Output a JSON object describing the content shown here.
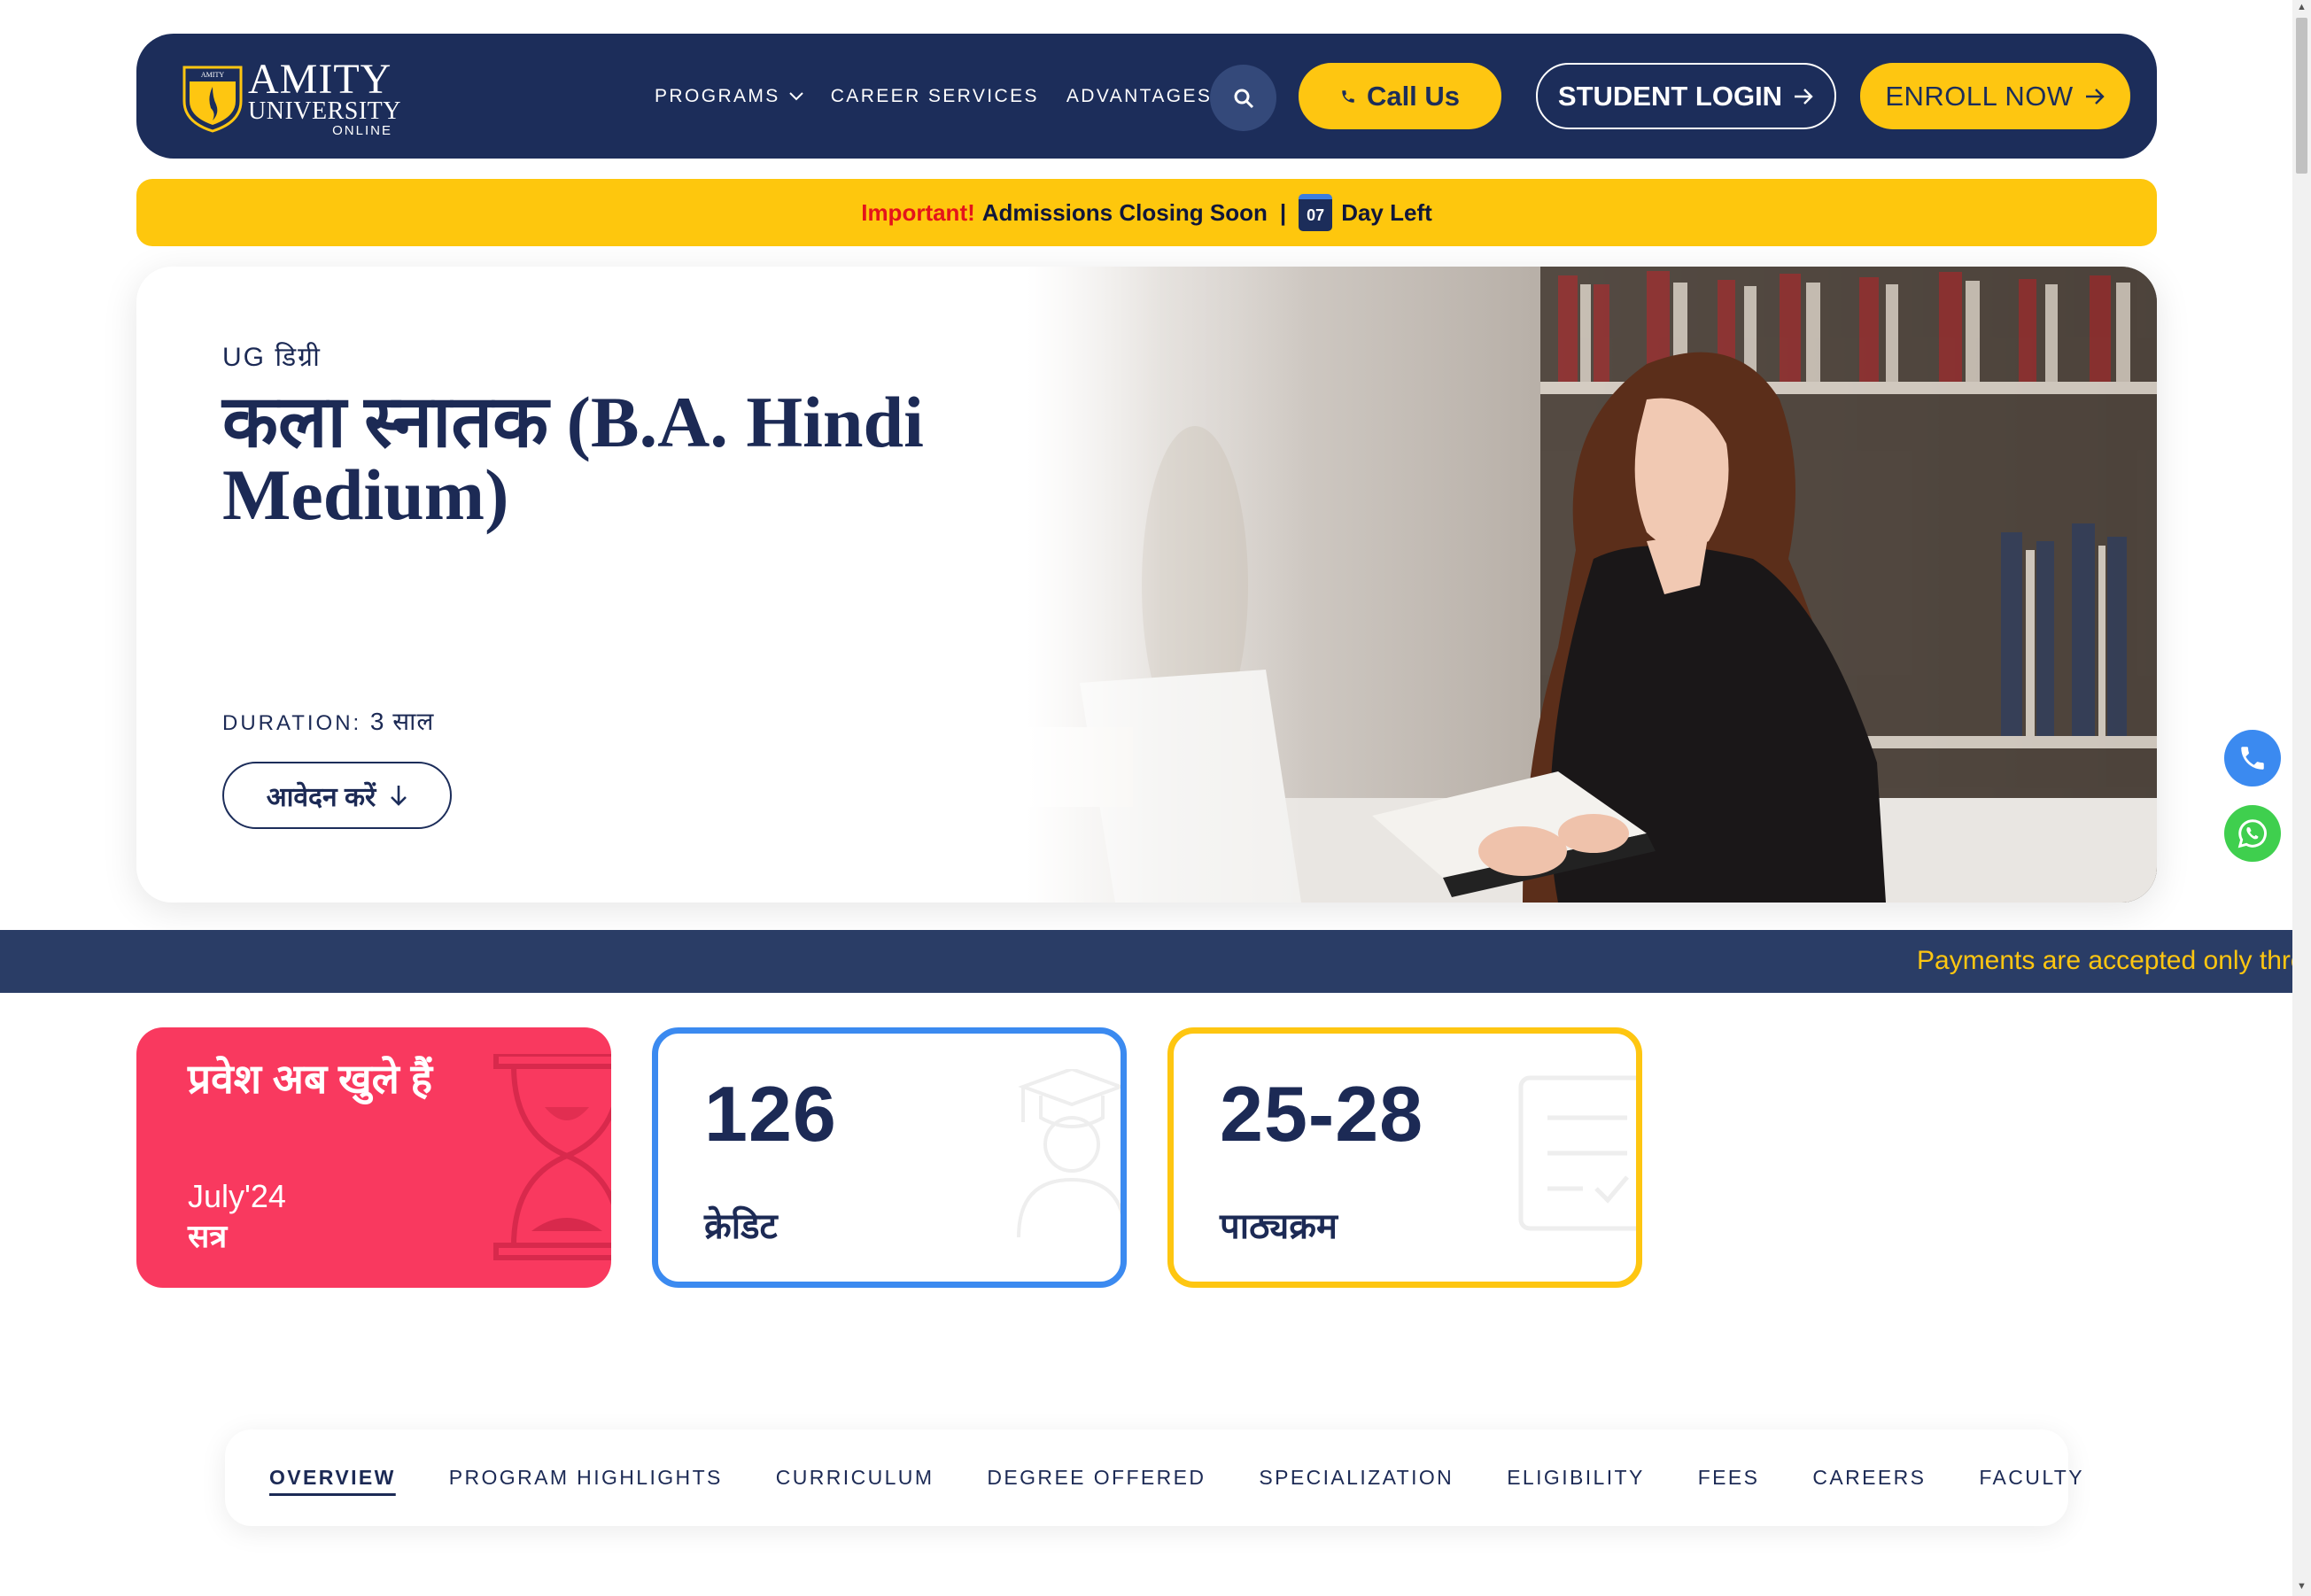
{
  "brand": {
    "name_line1": "AMITY",
    "name_line2": "UNIVERSITY",
    "name_line3": "ONLINE",
    "shield_text": "AMITY UNIVERSITY",
    "navy": "#1c2d5a",
    "yellow": "#fec611"
  },
  "nav": {
    "items": [
      {
        "label": "PROGRAMS",
        "has_dropdown": true
      },
      {
        "label": "CAREER SERVICES"
      },
      {
        "label": "ADVANTAGES"
      }
    ],
    "search_icon": "search-icon",
    "call_label": "Call Us",
    "login_label": "STUDENT LOGIN",
    "enroll_label": "ENROLL NOW"
  },
  "notice": {
    "important": "Important!",
    "message": "Admissions Closing Soon",
    "separator": "|",
    "days": "07",
    "days_suffix": "Day Left"
  },
  "hero": {
    "eyebrow": "UG डिग्री",
    "title": "कला स्नातक (B.A. Hindi Medium)",
    "duration_label": "DURATION:",
    "duration_value": "3 साल",
    "apply_label": "आवेदन करें"
  },
  "marquee": {
    "text": "Payments are accepted only thro"
  },
  "cards": {
    "admission": {
      "heading": "प्रवेश अब खुले हैं",
      "session": "July'24",
      "session_label": "सत्र",
      "color": "#f9395f"
    },
    "credits": {
      "value": "126",
      "label": "क्रेडिट",
      "color": "#3b8af0"
    },
    "courses": {
      "value": "25-28",
      "label": "पाठ्यक्रम",
      "color": "#fec611"
    }
  },
  "tabs": [
    {
      "label": "OVERVIEW",
      "active": true
    },
    {
      "label": "PROGRAM HIGHLIGHTS"
    },
    {
      "label": "CURRICULUM"
    },
    {
      "label": "DEGREE OFFERED"
    },
    {
      "label": "SPECIALIZATION"
    },
    {
      "label": "ELIGIBILITY"
    },
    {
      "label": "FEES"
    },
    {
      "label": "CAREERS"
    },
    {
      "label": "FACULTY"
    }
  ]
}
